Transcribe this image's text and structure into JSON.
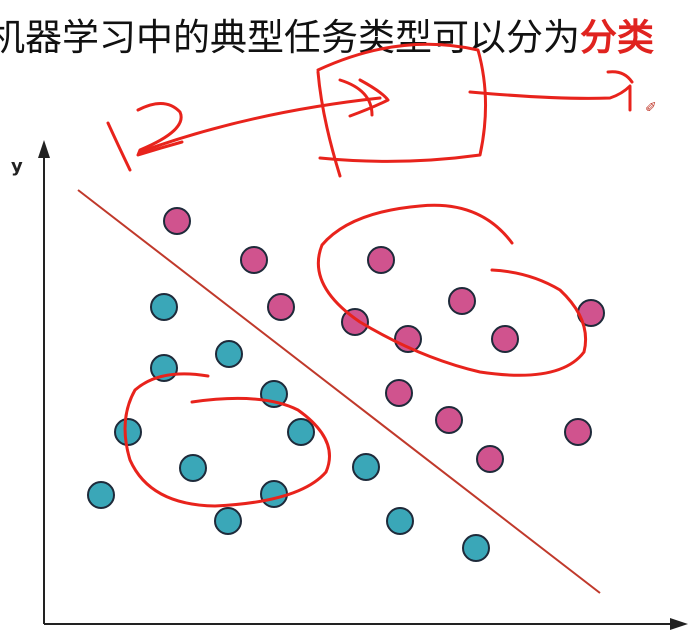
{
  "headline": {
    "text_main": "机器学习中的典型任务类型可以分为",
    "text_highlight": "分类"
  },
  "axes": {
    "y_label": "y"
  },
  "colors": {
    "pink": "#d0538e",
    "teal": "#3aa7b8",
    "point_border": "#1e2a3a",
    "boundary": "#c0392b",
    "ink": "#e8231c"
  },
  "icons": {
    "pen_cursor": "pen-cursor-icon"
  },
  "pink_points": [
    [
      177,
      221
    ],
    [
      254,
      260
    ],
    [
      381,
      260
    ],
    [
      281,
      307
    ],
    [
      355,
      322
    ],
    [
      462,
      301
    ],
    [
      408,
      339
    ],
    [
      505,
      339
    ],
    [
      591,
      313
    ],
    [
      399,
      393
    ],
    [
      449,
      420
    ],
    [
      490,
      459
    ],
    [
      578,
      432
    ]
  ],
  "teal_points": [
    [
      164,
      307
    ],
    [
      229,
      354
    ],
    [
      164,
      368
    ],
    [
      274,
      394
    ],
    [
      128,
      432
    ],
    [
      301,
      432
    ],
    [
      193,
      468
    ],
    [
      366,
      467
    ],
    [
      101,
      495
    ],
    [
      274,
      494
    ],
    [
      228,
      521
    ],
    [
      400,
      521
    ],
    [
      476,
      548
    ]
  ]
}
